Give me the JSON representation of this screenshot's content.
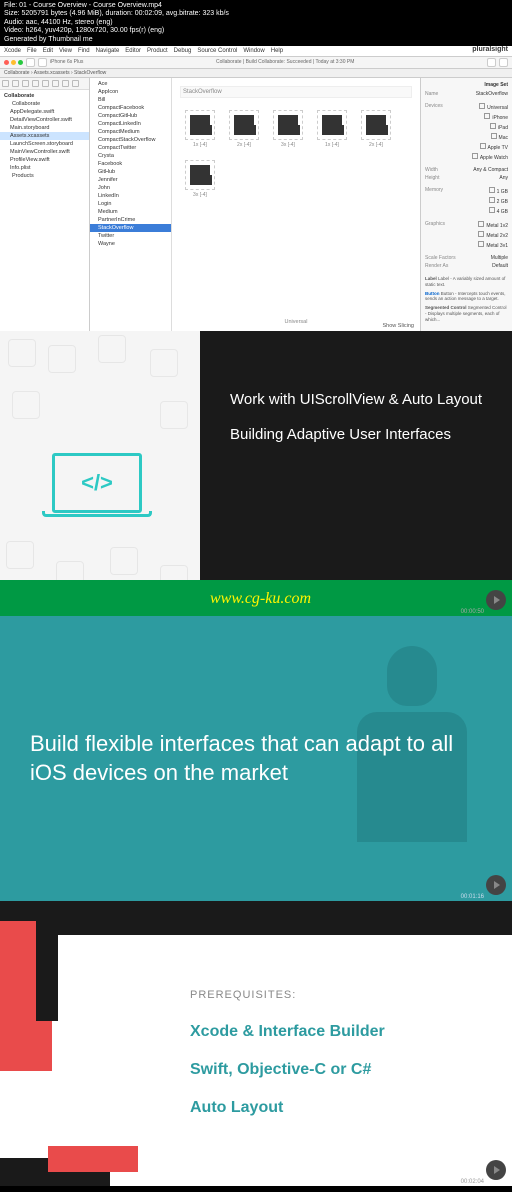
{
  "meta": {
    "file": "File: 01 - Course Overview - Course Overview.mp4",
    "size": "Size: 5205791 bytes (4.96 MiB), duration: 00:02:09, avg.bitrate: 323 kb/s",
    "audio": "Audio: aac, 44100 Hz, stereo (eng)",
    "video": "Video: h264, yuv420p, 1280x720, 30.00 fps(r) (eng)",
    "gen": "Generated by Thumbnail me"
  },
  "xcode": {
    "brand": "pluralsight",
    "menu": [
      "Xcode",
      "File",
      "Edit",
      "View",
      "Find",
      "Navigate",
      "Editor",
      "Product",
      "Debug",
      "Source Control",
      "Window",
      "Help"
    ],
    "scheme": "iPhone 6s Plus",
    "status": "Collaborate | Build Collaborate: Succeeded | Today at 3:30 PM",
    "breadcrumb": "Collaborate › Assets.xcassets › StackOverflow",
    "tree": {
      "root": "Collaborate",
      "items": [
        "Collaborate",
        "AppDelegate.swift",
        "DetailViewController.swift",
        "Main.storyboard",
        "Assets.xcassets",
        "LaunchScreen.storyboard",
        "MainViewController.swift",
        "ProfileView.swift",
        "Info.plist",
        "Products"
      ]
    },
    "assets": {
      "title": "StackOverflow",
      "list": [
        "Ace",
        "AppIcon",
        "Bill",
        "CompactFacebook",
        "CompactGitHub",
        "CompactLinkedIn",
        "CompactMedium",
        "CompactStackOverflow",
        "CompactTwitter",
        "Crysta",
        "Facebook",
        "GitHub",
        "Jennifer",
        "John",
        "LinkedIn",
        "Login",
        "Medium",
        "PartnerInCrime",
        "StackOverflow",
        "Twitter",
        "Wayne"
      ],
      "selected": "StackOverflow",
      "thumbs": [
        "1x [-4]",
        "2x [-4]",
        "3x [-4]",
        "1x [-4]",
        "2x [-4]",
        "3x [-4]"
      ],
      "universal": "Universal",
      "slicing": "Show Slicing"
    },
    "inspector": {
      "header": "Image Set",
      "name_k": "Name",
      "name_v": "StackOverflow",
      "devices_k": "Devices",
      "dev_universal": "Universal",
      "dev_iphone": "iPhone",
      "dev_ipad": "iPad",
      "dev_mac": "Mac",
      "dev_tv": "Apple TV",
      "dev_watch": "Apple Watch",
      "width_k": "Width",
      "width_v": "Any & Compact",
      "height_k": "Height",
      "height_v": "Any",
      "memory_k": "Memory",
      "mem1": "1 GB",
      "mem2": "2 GB",
      "mem3": "4 GB",
      "graphics_k": "Graphics",
      "g1": "Metal 1v2",
      "g2": "Metal 2v2",
      "g3": "Metal 3v1",
      "scale_k": "Scale Factors",
      "scale_v": "Multiple",
      "render_k": "Render As",
      "render_v": "Default",
      "label_k": "Label",
      "label_v": "Label - A variably sized amount of static text.",
      "button_k": "Button",
      "button_v": "Button - Intercepts touch events, sends an action message to a target.",
      "seg_k": "Segmented Control",
      "seg_v": "Segmented Control - Displays multiple segments, each of which..."
    }
  },
  "slide2": {
    "line1": "Work with UIScrollView & Auto Layout",
    "line2": "Building Adaptive User Interfaces",
    "url": "www.cg-ku.com",
    "time": "00:00:50",
    "code": "</>"
  },
  "slide3": {
    "text": "Build flexible interfaces that can adapt to all iOS devices on the market",
    "time": "00:01:16"
  },
  "slide4": {
    "heading": "PREREQUISITES:",
    "items": [
      "Xcode & Interface Builder",
      "Swift, Objective-C or C#",
      "Auto Layout"
    ],
    "time": "00:02:04"
  }
}
